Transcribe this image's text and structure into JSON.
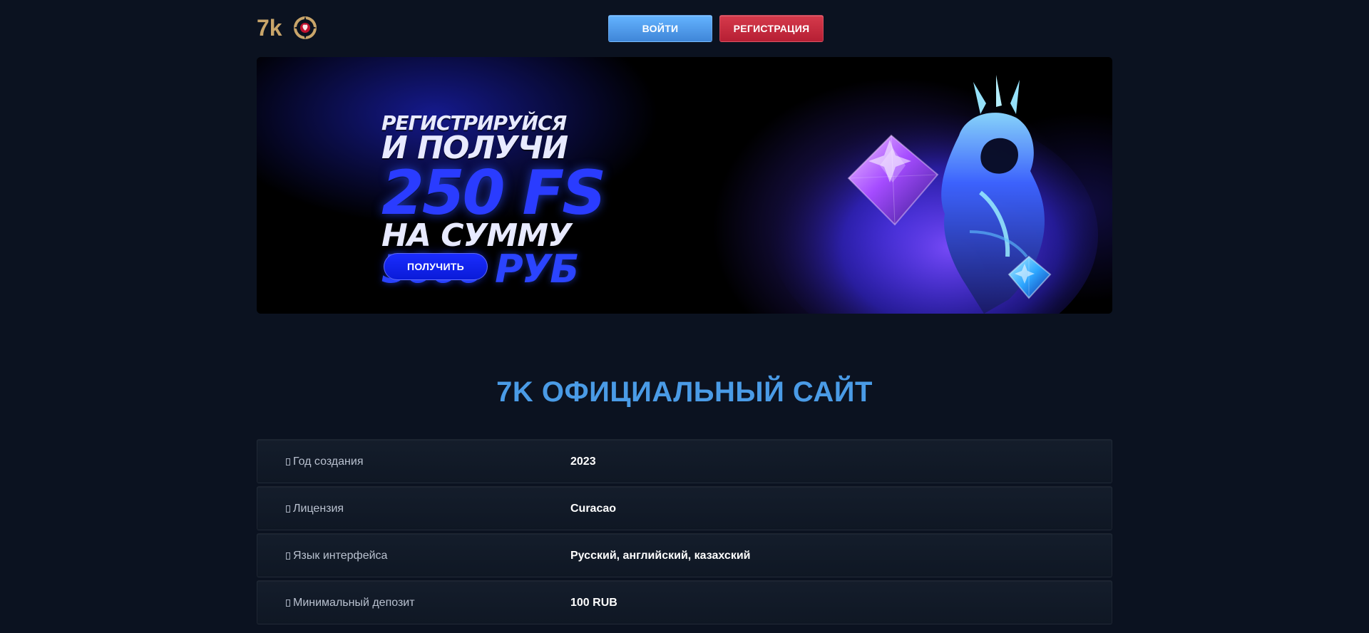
{
  "header": {
    "logo_text": "7k",
    "login_label": "ВОЙТИ",
    "register_label": "РЕГИСТРАЦИЯ"
  },
  "banner": {
    "line1": "РЕГИСТРИРУЙСЯ",
    "line2_left": "И ПОЛУЧИ",
    "line2_right": "250 FS",
    "line3_left": "НА СУММУ",
    "line3_right": "5000 РУБ",
    "cta_label": "ПОЛУЧИТЬ"
  },
  "page": {
    "title": "7K ОФИЦИАЛЬНЫЙ САЙТ"
  },
  "info_rows": [
    {
      "label": "Год создания",
      "value": "2023"
    },
    {
      "label": "Лицензия",
      "value": "Curacao"
    },
    {
      "label": "Язык интерфейса",
      "value": "Русский, английский, казахский"
    },
    {
      "label": "Минимальный депозит",
      "value": "100 RUB"
    }
  ],
  "colors": {
    "background": "#0b1220",
    "login": "#4f9bf0",
    "register": "#c92b40",
    "title": "#4a9be6",
    "banner_accent": "#2a3cff"
  },
  "icons": {
    "logo": "7k-chip-logo-icon",
    "row_marker": "square-marker-icon"
  }
}
